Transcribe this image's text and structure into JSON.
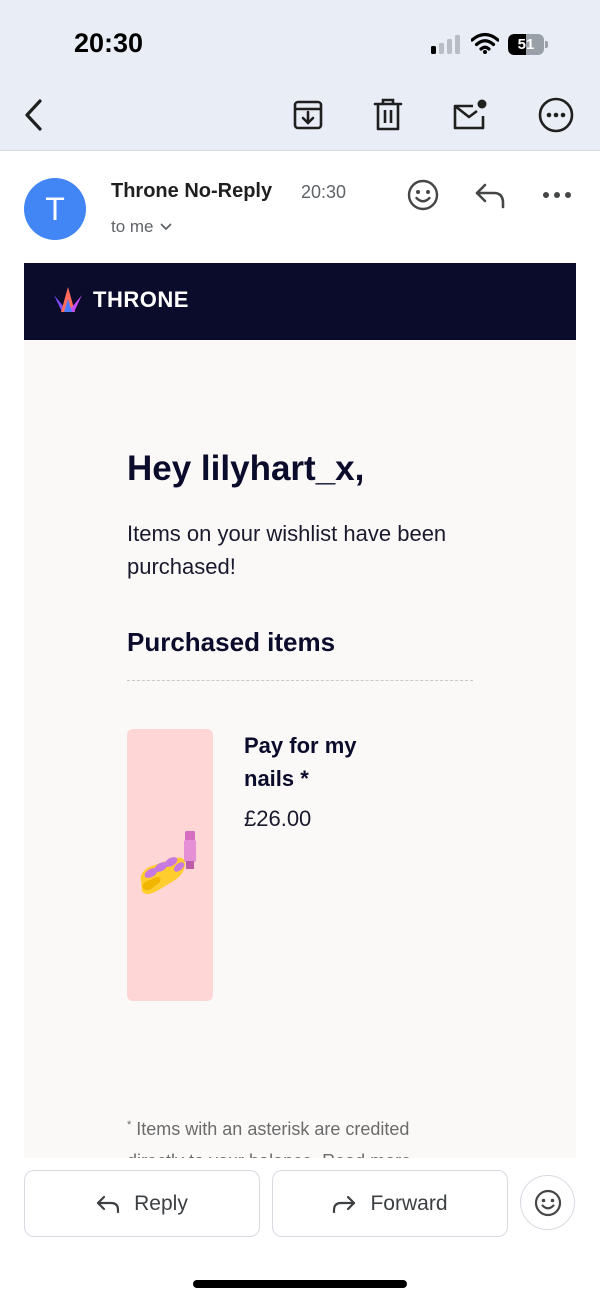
{
  "status_bar": {
    "time": "20:30",
    "signal_bars_filled": 1,
    "signal_bars_total": 4,
    "battery_percent": "51",
    "battery_level": 0.51
  },
  "toolbar": {
    "icons": [
      "back-icon",
      "archive-icon",
      "delete-icon",
      "mark-unread-icon",
      "more-options-icon"
    ]
  },
  "email": {
    "avatar_letter": "T",
    "sender": "Throne No-Reply",
    "time": "20:30",
    "recipient": "to me",
    "header_icons": [
      "emoji-react-icon",
      "reply-icon",
      "more-icon"
    ]
  },
  "message": {
    "brand_name": "THRONE",
    "greeting": "Hey lilyhart_x,",
    "intro": "Items on your wishlist have been purchased!",
    "section_title": "Purchased items",
    "items": [
      {
        "name": "Pay for my nails *",
        "price": "£26.00",
        "emoji": "nail-polish"
      }
    ],
    "footnote_marker": "*",
    "footnote_text": " Items with an asterisk are credited directly to your balance. Read more"
  },
  "actions": {
    "reply_label": "Reply",
    "forward_label": "Forward"
  },
  "colors": {
    "header_bg": "#e9eef6",
    "avatar": "#4285f4",
    "brand_bar": "#0b0b2b",
    "item_card": "#ffd6d6",
    "email_bg": "#faf9f8"
  }
}
